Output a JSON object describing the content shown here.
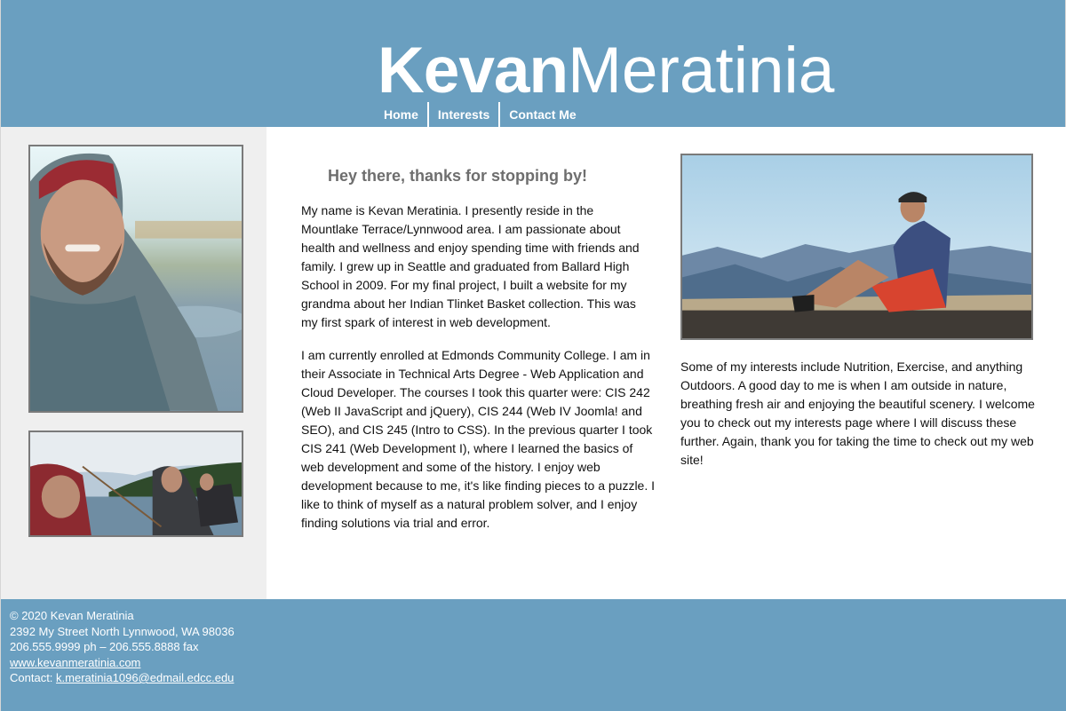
{
  "header": {
    "logo_bold": "Kevan",
    "logo_light": "Meratinia",
    "nav": [
      "Home",
      "Interests",
      "Contact Me"
    ]
  },
  "main": {
    "heading": "Hey there, thanks for stopping by!",
    "paragraph1": "My name is Kevan Meratinia. I presently reside in the Mountlake Terrace/Lynnwood area. I am passionate about health and wellness and enjoy spending time with friends and family. I grew up in Seattle and graduated from Ballard High School in 2009. For my final project, I built a website for my grandma about her Indian Tlinket Basket collection. This was my first spark of interest in web development.",
    "paragraph2": "I am currently enrolled at Edmonds Community College. I am in their Associate in Technical Arts Degree - Web Application and Cloud Developer. The courses I took this quarter were: CIS 242 (Web II JavaScript and jQuery), CIS 244 (Web IV Joomla! and SEO), and CIS 245 (Intro to CSS). In the previous quarter I took CIS 241 (Web Development I), where I learned the basics of web development and some of the history. I enjoy web development because to me, it's like finding pieces to a puzzle. I like to think of myself as a natural problem solver, and I enjoy finding solutions via trial and error."
  },
  "aside": {
    "paragraph": "Some of my interests include Nutrition, Exercise, and anything Outdoors. A good day to me is when I am outside in nature, breathing fresh air and enjoying the beautiful scenery. I welcome you to check out my interests page where I will discuss these further. Again, thank you for taking the time to check out my web site!"
  },
  "footer": {
    "copyright": "© 2020 Kevan Meratinia",
    "address": "2392 My Street North Lynnwood, WA 98036",
    "phone": "206.555.9999 ph – 206.555.8888 fax",
    "website": "www.kevanmeratinia.com",
    "contact_label": "Contact:",
    "email": "k.meratinia1096@edmail.edcc.edu"
  },
  "colors": {
    "brand_blue": "#6a9fc0",
    "sidebar_gray": "#efefef"
  }
}
